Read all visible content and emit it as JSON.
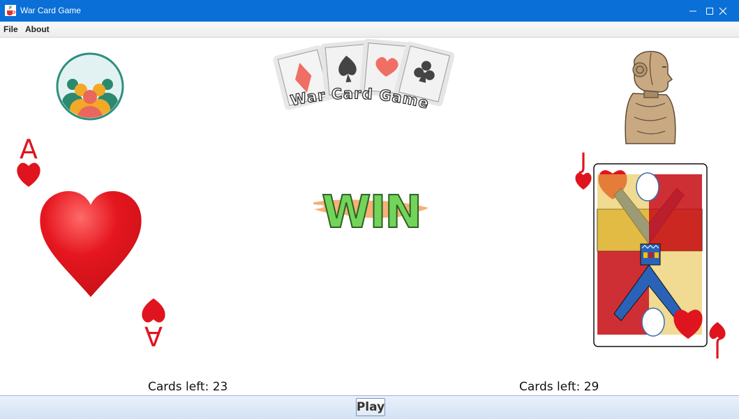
{
  "window": {
    "title": "War Card Game",
    "icon": "java-cup-icon"
  },
  "menu": {
    "items": [
      "File",
      "About"
    ]
  },
  "logo": {
    "text": "War Card Game"
  },
  "players": {
    "left": {
      "avatar": "group-people-icon",
      "cards_left_label": "Cards left: 23",
      "card": {
        "rank": "A",
        "suit": "hearts"
      }
    },
    "right": {
      "avatar": "robot-head-icon",
      "cards_left_label": "Cards left: 29",
      "card": {
        "rank": "J",
        "suit": "hearts"
      }
    }
  },
  "result": {
    "text": "WIN"
  },
  "play_button": {
    "label": "Play"
  },
  "colors": {
    "titlebar": "#0a6fd6",
    "card_red": "#e0141e",
    "win_green": "#6ed25a",
    "win_splash": "#f28a3a"
  }
}
